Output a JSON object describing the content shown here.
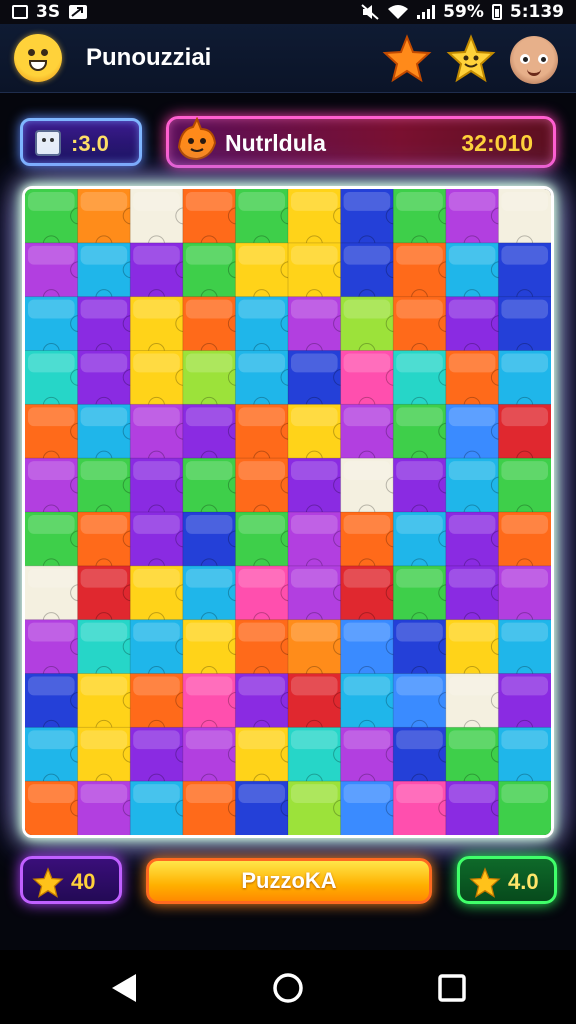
{
  "status_bar": {
    "left_text": "3S",
    "battery_pct": "59%",
    "time": "5:139"
  },
  "header": {
    "title": "Punouzziai"
  },
  "hud_top": {
    "score": ":3.0",
    "level_title": "Nutrldula",
    "level_value": "32:010"
  },
  "hud_bottom": {
    "left_stars": "40",
    "action_label": "PuzzoKA",
    "right_stars": "4.0"
  },
  "board": {
    "rows": 12,
    "cols": 10,
    "tile_colors": [
      "#8a2be2",
      "#ff8c1a",
      "#ffd319",
      "#3ecf4a",
      "#1fb6ea",
      "#e0282f",
      "#2440d8",
      "#b23fe0",
      "#ff6a1a",
      "#3a8bff",
      "#9ce23a",
      "#f4f0e0",
      "#ff4fae",
      "#26d6c8"
    ],
    "board_colors": [
      [
        3,
        1,
        11,
        8,
        3,
        2,
        6,
        3,
        7,
        11
      ],
      [
        7,
        4,
        0,
        3,
        2,
        2,
        6,
        8,
        4,
        6
      ],
      [
        4,
        0,
        2,
        8,
        4,
        7,
        10,
        8,
        0,
        6
      ],
      [
        13,
        0,
        2,
        10,
        4,
        6,
        12,
        13,
        8,
        4
      ],
      [
        8,
        4,
        7,
        0,
        8,
        2,
        7,
        3,
        9,
        5
      ],
      [
        7,
        3,
        0,
        3,
        8,
        0,
        11,
        0,
        4,
        3
      ],
      [
        3,
        8,
        0,
        6,
        3,
        7,
        8,
        4,
        0,
        8
      ],
      [
        11,
        5,
        2,
        4,
        12,
        7,
        5,
        3,
        0,
        7
      ],
      [
        7,
        13,
        4,
        2,
        8,
        1,
        9,
        6,
        2,
        4
      ],
      [
        6,
        2,
        8,
        12,
        0,
        5,
        4,
        9,
        11,
        0
      ],
      [
        4,
        2,
        0,
        7,
        2,
        13,
        7,
        6,
        3,
        4
      ],
      [
        8,
        7,
        4,
        8,
        6,
        10,
        9,
        12,
        0,
        3
      ]
    ]
  },
  "icons": {
    "app_avatar": "smiley-face-icon",
    "header_star_1": "orange-star-icon",
    "header_star_2": "yellow-star-icon",
    "user_avatar": "user-face-icon",
    "score_icon": "robot-face-icon",
    "level_icon": "fox-mascot-icon",
    "bottom_star": "gold-star-icon",
    "nav_back": "back-triangle-icon",
    "nav_home": "home-circle-icon",
    "nav_recent": "recent-square-icon"
  }
}
